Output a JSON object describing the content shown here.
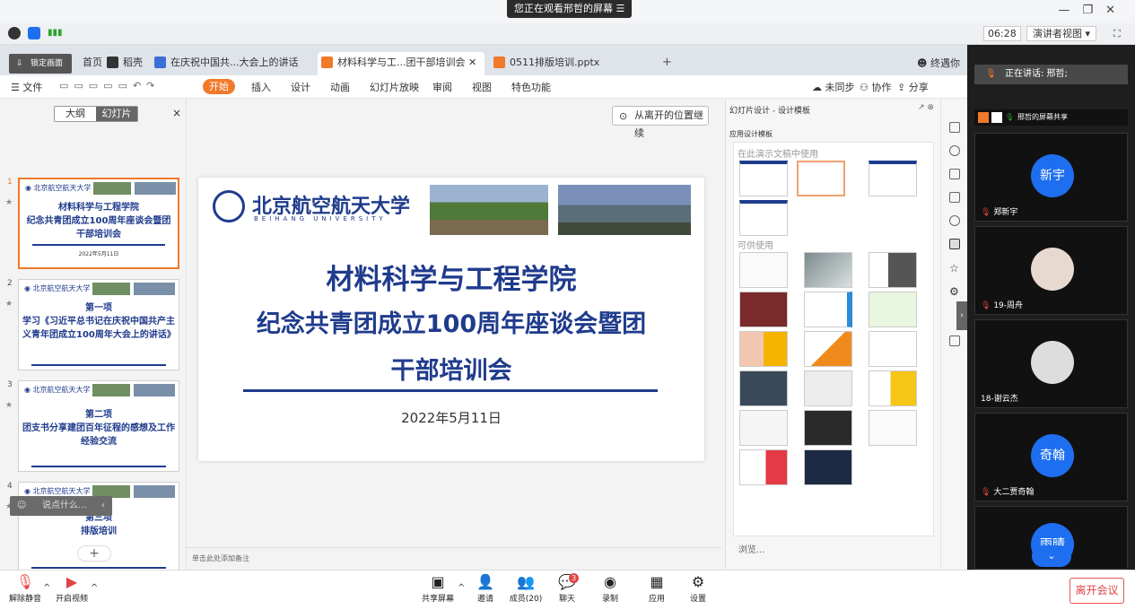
{
  "meeting": {
    "share_banner": "您正在观看邢哲的屏幕",
    "timer": "06:28",
    "view_mode": "演讲者视图",
    "speaking": "正在讲话: 邢哲;",
    "sharer_label": "邢哲的屏幕共享",
    "lock_screen": "锁定画面",
    "comment_placeholder": "说点什么...",
    "leave": "离开会议"
  },
  "tabs": [
    {
      "label": "首页"
    },
    {
      "label": "稻壳"
    },
    {
      "label": "在庆祝中国共...大会上的讲话"
    },
    {
      "label": "材料科学与工...团干部培训会"
    },
    {
      "label": "0511排版培训.pptx"
    }
  ],
  "user": "终遇你",
  "menu": {
    "file": "文件",
    "start": "开始",
    "items": [
      "插入",
      "设计",
      "动画",
      "幻灯片放映",
      "审阅",
      "视图",
      "特色功能"
    ],
    "sync": "未同步",
    "collab": "协作",
    "share": "分享"
  },
  "thumbs_panel": {
    "outline": "大纲",
    "slides": "幻灯片",
    "close": "×",
    "add": "+"
  },
  "thumbs": [
    {
      "num": "1",
      "title": "材料科学与工程学院\n纪念共青团成立100周年座谈会暨团干部培训会",
      "date": "2022年5月11日"
    },
    {
      "num": "2",
      "title": "第一项\n学习《习近平总书记在庆祝中国共产主义青年团成立100周年大会上的讲话》",
      "date": ""
    },
    {
      "num": "3",
      "title": "第二项\n团支书分享建团百年征程的感想及工作经验交流",
      "date": ""
    },
    {
      "num": "4",
      "title": "第三项\n排版培训",
      "date": ""
    }
  ],
  "slide": {
    "logo_cn": "北京航空航天大学",
    "logo_en": "BEIHANG UNIVERSITY",
    "title1": "材料科学与工程学院",
    "title2": "纪念共青团成立100周年座谈会暨团",
    "title3": "干部培训会",
    "date": "2022年5月11日",
    "resume": "从离开的位置继续",
    "notes": "单击此处添加备注"
  },
  "design": {
    "header": "幻灯片设计 - 设计模板",
    "apply": "应用设计模板",
    "used": "在此演示文稿中使用",
    "available": "可供使用",
    "browse": "浏览..."
  },
  "participants": [
    {
      "name": "郑新宇",
      "avatar": "新宇"
    },
    {
      "name": "19-周舟",
      "avatar": ""
    },
    {
      "name": "18-谢云杰",
      "avatar": ""
    },
    {
      "name": "大二贾奇翰",
      "avatar": "奇翰"
    },
    {
      "name": "",
      "avatar": "雨晴"
    }
  ],
  "toolbar": [
    {
      "label": "解除静音",
      "icon": "mic-muted-icon"
    },
    {
      "label": "开启视频",
      "icon": "video-off-icon"
    },
    {
      "label": "共享屏幕",
      "icon": "share-screen-icon"
    },
    {
      "label": "邀请",
      "icon": "invite-icon"
    },
    {
      "label": "成员(20)",
      "icon": "members-icon"
    },
    {
      "label": "聊天",
      "icon": "chat-icon"
    },
    {
      "label": "录制",
      "icon": "record-icon"
    },
    {
      "label": "应用",
      "icon": "apps-icon"
    },
    {
      "label": "设置",
      "icon": "settings-icon"
    }
  ],
  "chat_badge": "3",
  "colors": {
    "accent": "#f0792a",
    "brand_blue": "#1f3b8c",
    "avatar_blue": "#1e6ff0",
    "leave_red": "#e04444"
  }
}
